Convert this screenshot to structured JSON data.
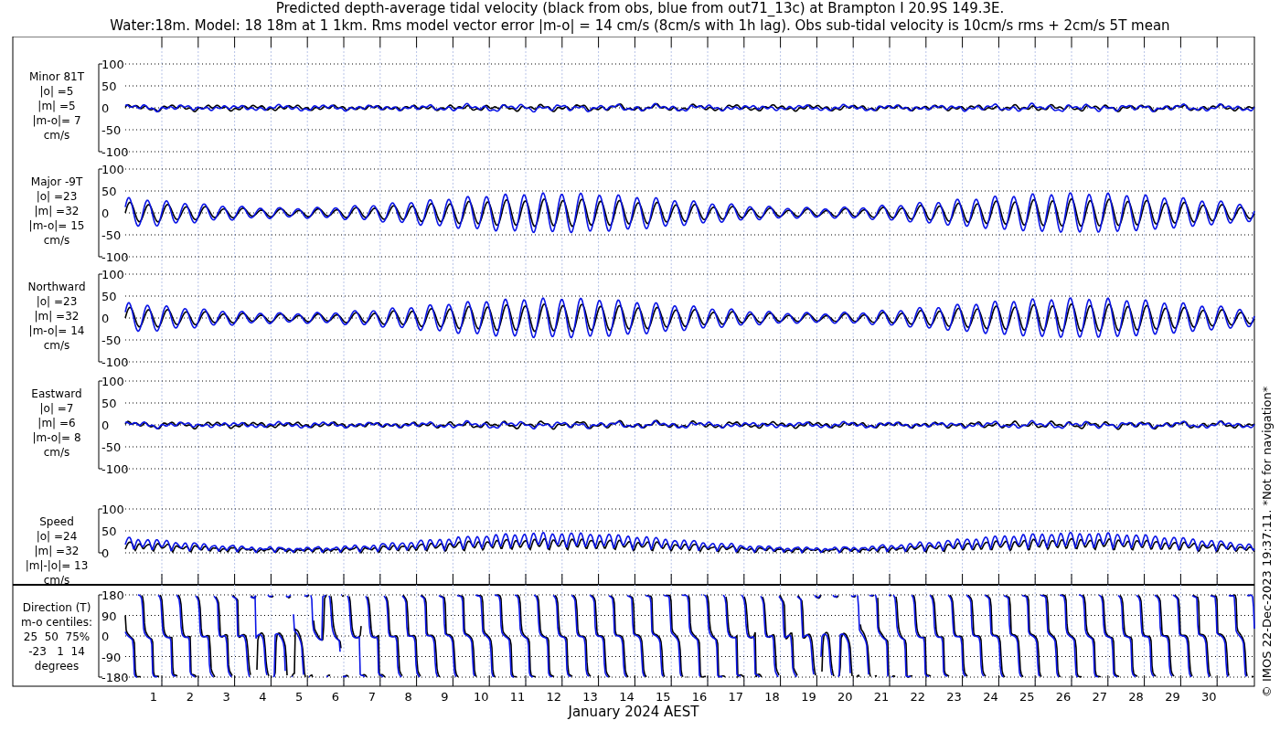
{
  "title": [
    "Predicted depth-average tidal velocity (black from obs, blue from out71_13c) at Brampton I 20.9S 149.3E.",
    "Water:18m. Model: 18 18m at 1 1km. Rms model vector error |m-o| = 14 cm/s (8cm/s with 1h lag). Obs sub-tidal velocity is 10cm/s rms + 2cm/s 5T mean"
  ],
  "panels": [
    {
      "kind": "velocity",
      "labels": [
        "Minor 81T",
        "|o| =5",
        "|m| =5",
        "|m-o|= 7",
        "cm/s"
      ],
      "yticks": [
        "100",
        "50",
        "0",
        "-50",
        "-100"
      ]
    },
    {
      "kind": "velocity",
      "labels": [
        "Major -9T",
        "|o| =23",
        "|m| =32",
        "|m-o|= 15",
        "cm/s"
      ],
      "yticks": [
        "100",
        "50",
        "0",
        "-50",
        "-100"
      ]
    },
    {
      "kind": "velocity",
      "labels": [
        "Northward",
        "|o| =23",
        "|m| =32",
        "|m-o|= 14",
        "cm/s"
      ],
      "yticks": [
        "100",
        "50",
        "0",
        "-50",
        "-100"
      ]
    },
    {
      "kind": "velocity",
      "labels": [
        "Eastward",
        "|o| =7",
        "|m| =6",
        "|m-o|= 8",
        "cm/s"
      ],
      "yticks": [
        "100",
        "50",
        "0",
        "-50",
        "-100"
      ]
    },
    {
      "kind": "speed",
      "labels": [
        "Speed",
        "|o| =24",
        "|m| =32",
        "|m|-|o|= 13",
        "cm/s"
      ],
      "yticks": [
        "100",
        "50",
        "0"
      ]
    },
    {
      "kind": "direction",
      "labels": [
        "Direction (T)",
        "m-o centiles:",
        "25  50  75%",
        "-23   1  14",
        "degrees"
      ],
      "yticks": [
        "180",
        "90",
        "0",
        "-90",
        "-180"
      ]
    }
  ],
  "x_axis": {
    "labels": [
      "1",
      "2",
      "3",
      "4",
      "5",
      "6",
      "7",
      "8",
      "9",
      "10",
      "11",
      "12",
      "13",
      "14",
      "15",
      "16",
      "17",
      "18",
      "19",
      "20",
      "21",
      "22",
      "23",
      "24",
      "25",
      "26",
      "27",
      "28",
      "29",
      "30"
    ],
    "title": "January 2024 AEST"
  },
  "footer": "© IMOS 22-Dec-2023 19:37:11. *Not for navigation*"
}
